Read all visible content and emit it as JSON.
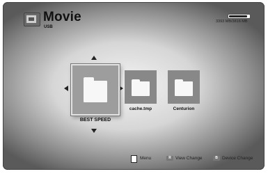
{
  "header": {
    "title": "Movie",
    "subtitle": "USB",
    "icon": "movie-folder-icon"
  },
  "storage": {
    "text": "3393 MB/3816 MB",
    "used_fraction": 0.89
  },
  "items": [
    {
      "name": "BEST SPEED",
      "selected": true
    },
    {
      "name": "cache.tmp",
      "selected": false
    },
    {
      "name": "Centurion",
      "selected": false
    }
  ],
  "footer": {
    "menu_label": "Menu",
    "view_change_key": "R",
    "view_change_label": "View Change",
    "device_change_key": "B",
    "device_change_label": "Device Change"
  }
}
